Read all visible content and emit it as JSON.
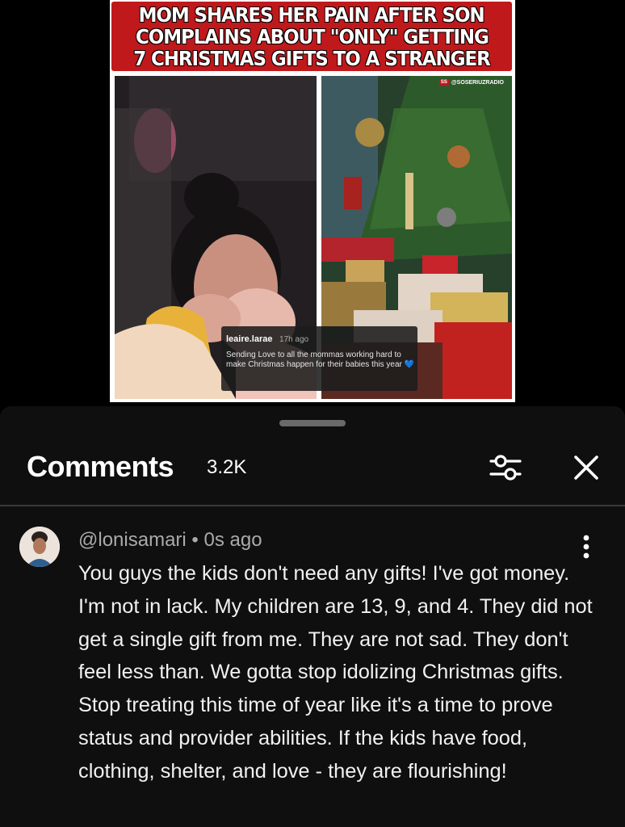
{
  "video": {
    "headline_lines": [
      "MOM SHARES HER PAIN AFTER SON",
      "COMPLAINS ABOUT \"ONLY\" GETTING",
      "7 CHRISTMAS GIFTS TO A STRANGER"
    ],
    "watermark": "@SOSERIUZRADIO",
    "watermark_logo": "SS",
    "overlay_comment": {
      "username": "leaire.larae",
      "time": "17h ago",
      "text": "Sending Love to all the mommas working hard to make Christmas happen for their babies this year",
      "emoji": "💙"
    }
  },
  "comments_panel": {
    "title": "Comments",
    "count": "3.2K",
    "icons": {
      "filter": "sliders-icon",
      "close": "close-icon",
      "more": "more-vertical-icon"
    },
    "comment": {
      "author": "@lonisamari",
      "separator": "•",
      "time": "0s ago",
      "text": "You guys the kids don't need any gifts! I've got money. I'm not in lack. My children are 13, 9, and 4. They did not get a single gift from me. They are not sad. They don't feel less than. We gotta stop idolizing Christmas gifts. Stop treating this time of year like it's a time to prove status and provider abilities. If the kids have food, clothing, shelter, and love - they are flourishing!"
    }
  }
}
